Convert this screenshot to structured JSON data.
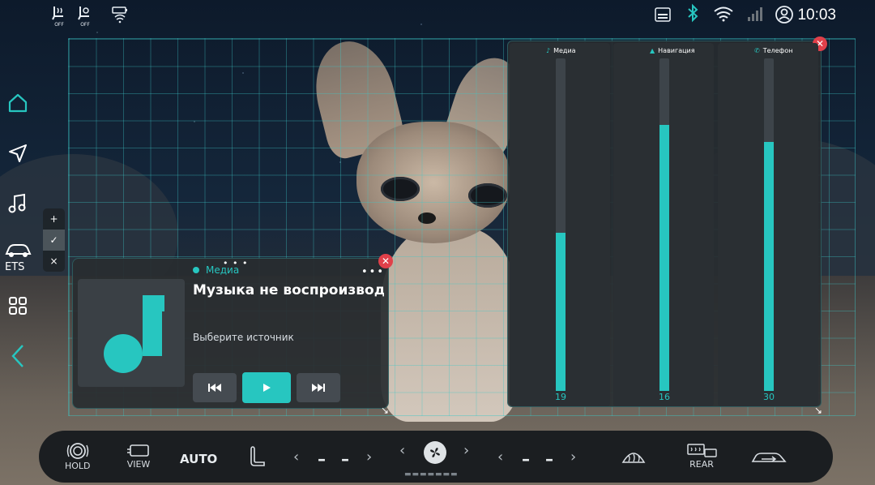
{
  "status_bar": {
    "seat_left_label": "OFF",
    "seat_right_label": "OFF",
    "time": "10:03",
    "icons": [
      "seat-heat-icon",
      "seat-vent-icon",
      "battery-signal-icon",
      "sd-card-icon",
      "bluetooth-icon",
      "wifi-icon",
      "cell-signal-icon",
      "user-icon"
    ]
  },
  "left_nav": {
    "items": [
      "home-icon",
      "navigation-icon",
      "music-icon",
      "car-icon",
      "apps-icon",
      "back-icon"
    ],
    "ets_label": "ETS"
  },
  "zoom_popup": {
    "plus": "+",
    "check": "✓",
    "close": "×"
  },
  "media_widget": {
    "source_label": "Медиа",
    "title": "Музыка не воспроизвод…",
    "subtitle": "Выберите источник",
    "more": "•••",
    "drag_dots": "• • •",
    "prev_icon": "⏮",
    "play_icon": "▶",
    "next_icon": "⏭",
    "close": "✕",
    "resize": "↘"
  },
  "volume_widget": {
    "drag_dots": "• • •",
    "close": "✕",
    "resize": "↘",
    "channels": [
      {
        "label": "Медиа",
        "icon": "♪",
        "value": 19,
        "max": 40
      },
      {
        "label": "Навигация",
        "icon": "▲",
        "value": 16,
        "max": 20
      },
      {
        "label": "Телефон",
        "icon": "✆",
        "value": 30,
        "max": 40
      }
    ]
  },
  "climate_bar": {
    "hold_label": "HOLD",
    "view_label": "VIEW",
    "auto_label": "AUTO",
    "left_temp": "– –",
    "right_temp": "– –",
    "rear_label": "REAR",
    "fan_levels": "▬▬▬▬▬▬▬"
  },
  "colors": {
    "accent": "#27c6c0",
    "close_red": "#e0404a",
    "grid": "#3cc8c8"
  }
}
